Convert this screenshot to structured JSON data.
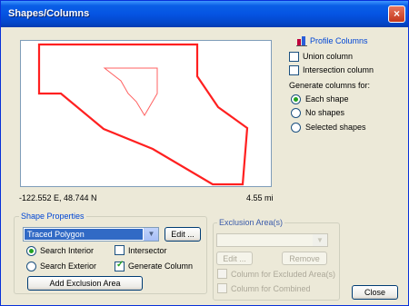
{
  "window": {
    "title": "Shapes/Columns",
    "close_glyph": "×"
  },
  "map": {
    "coords": "-122.552 E,   48.744 N",
    "distance": "4.55 mi",
    "shape_color": "#FF2020"
  },
  "profile_columns": {
    "title": "Profile Columns",
    "union_column": {
      "label": "Union column",
      "checked": false
    },
    "intersection_column": {
      "label": "Intersection column",
      "checked": false
    },
    "generate_label": "Generate columns for:",
    "options": [
      {
        "label": "Each shape",
        "selected": true
      },
      {
        "label": "No  shapes",
        "selected": false
      },
      {
        "label": "Selected shapes",
        "selected": false
      }
    ]
  },
  "shape_properties": {
    "title": "Shape Properties",
    "shape_select": "Traced Polygon",
    "edit_label": "Edit ...",
    "search_interior": "Search Interior",
    "search_exterior": "Search Exterior",
    "intersector": "Intersector",
    "generate_column": "Generate Column",
    "add_exclusion": "Add Exclusion Area"
  },
  "exclusion": {
    "title": "Exclusion Area(s)",
    "edit_label": "Edit ...",
    "remove_label": "Remove",
    "excluded_label": "Column for Excluded Area(s)",
    "combined_label": "Column for Combined"
  },
  "close_label": "Close"
}
